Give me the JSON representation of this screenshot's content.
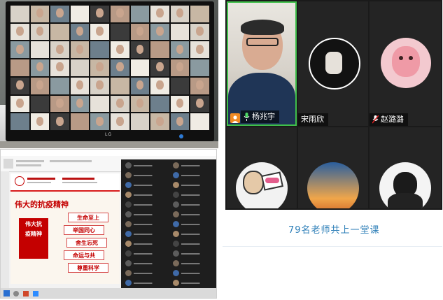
{
  "gallery": {
    "participants": [
      {
        "name": "杨兆宇",
        "mic": "on",
        "video": true,
        "host": true
      },
      {
        "name": "宋雨欣",
        "mic": "none",
        "video": false
      },
      {
        "name": "赵潞潞",
        "mic": "muted",
        "video": false
      },
      {
        "name": "",
        "mic": "none",
        "video": false
      },
      {
        "name": "",
        "mic": "none",
        "video": false
      },
      {
        "name": "",
        "mic": "none",
        "video": false
      }
    ]
  },
  "slide": {
    "title": "伟大的抗疫精神",
    "box_text": "伟大抗疫精神",
    "items": [
      "生命至上",
      "举国同心",
      "舍生忘死",
      "命运与共",
      "尊重科学"
    ]
  },
  "monitor": {
    "brand": "LG"
  },
  "caption": "79名老师共上一堂课",
  "colors": {
    "caption": "#2e7fb8",
    "slide_red": "#c40000",
    "host_orange": "#f08a24"
  }
}
